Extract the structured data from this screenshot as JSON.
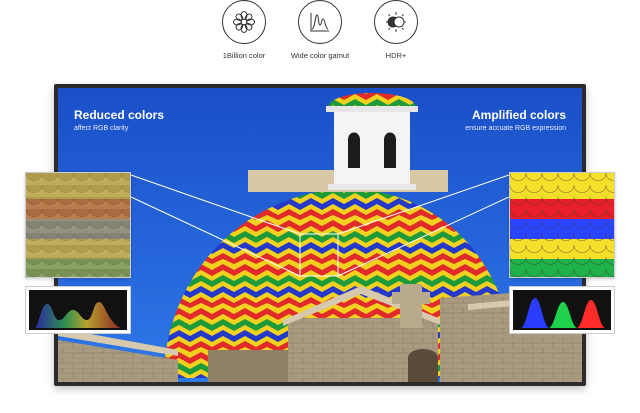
{
  "features": [
    {
      "icon": "flower-icon",
      "label": "1Billion color"
    },
    {
      "icon": "gamut-graph-icon",
      "label": "Wide color gamut"
    },
    {
      "icon": "hdr-icon",
      "label": "HDR+"
    }
  ],
  "left_panel": {
    "title": "Reduced colors",
    "subtitle": "affect RGB clarity"
  },
  "right_panel": {
    "title": "Amplified colors",
    "subtitle": "ensure accuate RGB expression"
  },
  "colors": {
    "sky": "#1f5fd6",
    "frame": "#2b2b2b",
    "dome_red": "#e12b2b",
    "dome_yellow": "#f2d21f",
    "dome_green": "#1f9a3a",
    "dome_blue": "#2438c9",
    "stone": "#a99a80"
  }
}
